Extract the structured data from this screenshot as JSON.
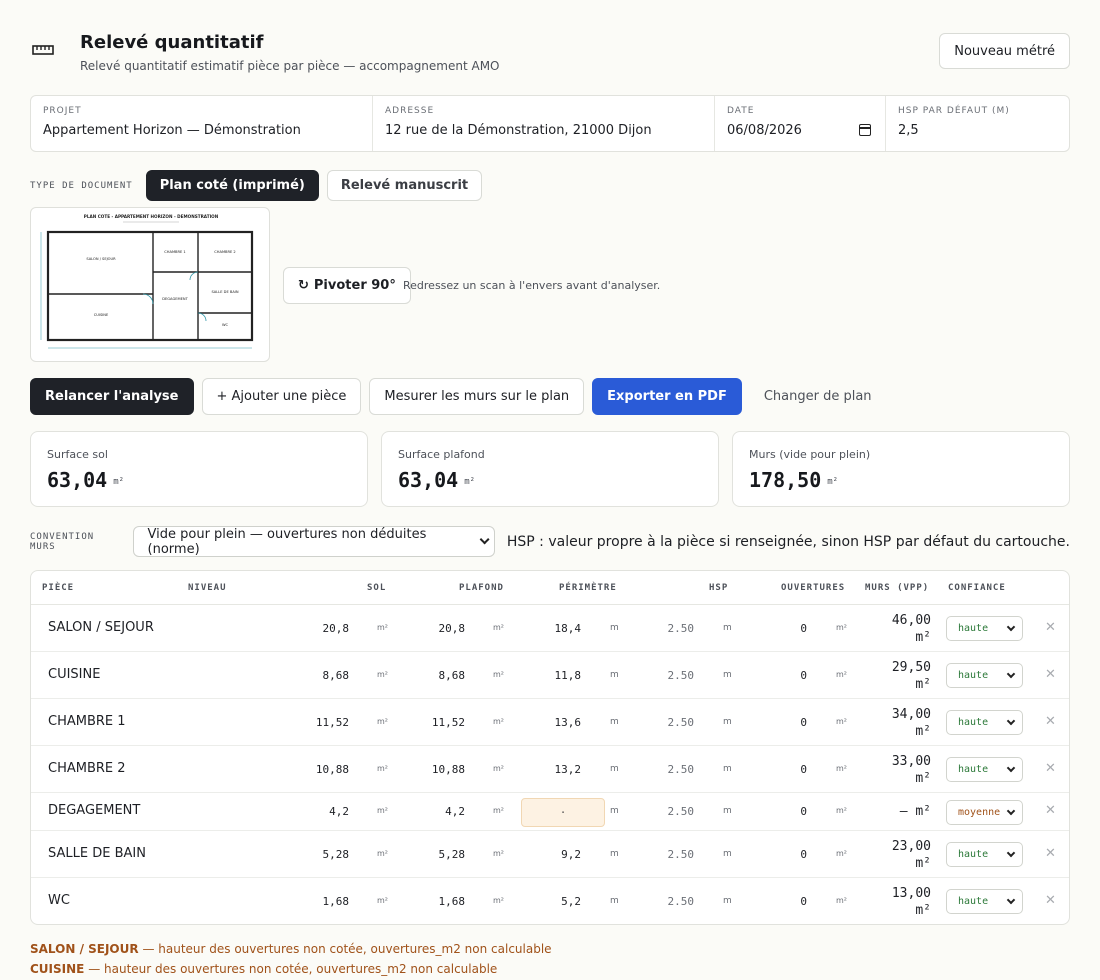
{
  "header": {
    "title": "Relevé quantitatif",
    "subtitle": "Relevé quantitatif estimatif pièce par pièce — accompagnement AMO",
    "new_button": "Nouveau métré",
    "icon": "ruler-icon"
  },
  "project": {
    "fields": [
      {
        "label": "PROJET",
        "value": "Appartement Horizon — Démonstration"
      },
      {
        "label": "ADRESSE",
        "value": "12 rue de la Démonstration, 21000 Dijon"
      },
      {
        "label": "DATE",
        "value": "06/08/2026"
      },
      {
        "label": "HSP PAR DÉFAUT (M)",
        "value": "2,5"
      }
    ]
  },
  "doc_type": {
    "label": "TYPE DE DOCUMENT",
    "options": [
      "Plan coté (imprimé)",
      "Relevé manuscrit"
    ],
    "selected": "Plan coté (imprimé)"
  },
  "plan": {
    "title": "PLAN COTE - APPARTEMENT HORIZON - DEMONSTRATION",
    "rooms": [
      "SALON / SEJOUR",
      "CHAMBRE 1",
      "CHAMBRE 2",
      "SALLE DE BAIN",
      "DEGAGEMENT",
      "CUISINE",
      "WC"
    ],
    "rotate_button": "Pivoter 90°",
    "rotate_hint": "Redressez un scan à l'envers avant d'analyser."
  },
  "actions": {
    "rerun": "Relancer l'analyse",
    "add_room": "+ Ajouter une pièce",
    "measure_walls": "Mesurer les murs sur le plan",
    "export_pdf": "Exporter en PDF",
    "change_plan": "Changer de plan"
  },
  "summary": [
    {
      "label": "Surface sol",
      "value": "63,04",
      "unit": "m²"
    },
    {
      "label": "Surface plafond",
      "value": "63,04",
      "unit": "m²"
    },
    {
      "label": "Murs (vide pour plein)",
      "value": "178,50",
      "unit": "m²"
    }
  ],
  "convention": {
    "label": "CONVENTION MURS",
    "selected": "Vide pour plein — ouvertures non déduites (norme)",
    "note": "HSP : valeur propre à la pièce si renseignée, sinon HSP par défaut du cartouche."
  },
  "table": {
    "headers": [
      "PIÈCE",
      "NIVEAU",
      "SOL",
      "PLAFOND",
      "PÉRIMÈTRE",
      "HSP",
      "OUVERTURES",
      "MURS (VPP)",
      "CONFIANCE"
    ],
    "unit_m2": "m²",
    "unit_m": "m",
    "rows": [
      {
        "name": "SALON / SEJOUR",
        "sol": "20,8",
        "plafond": "20,8",
        "perimetre": "18,4",
        "hsp": "2.50",
        "ouvertures": "0",
        "murs": "46,00",
        "confiance": "haute"
      },
      {
        "name": "CUISINE",
        "sol": "8,68",
        "plafond": "8,68",
        "perimetre": "11,8",
        "hsp": "2.50",
        "ouvertures": "0",
        "murs": "29,50",
        "confiance": "haute"
      },
      {
        "name": "CHAMBRE 1",
        "sol": "11,52",
        "plafond": "11,52",
        "perimetre": "13,6",
        "hsp": "2.50",
        "ouvertures": "0",
        "murs": "34,00",
        "confiance": "haute"
      },
      {
        "name": "CHAMBRE 2",
        "sol": "10,88",
        "plafond": "10,88",
        "perimetre": "13,2",
        "hsp": "2.50",
        "ouvertures": "0",
        "murs": "33,00",
        "confiance": "haute"
      },
      {
        "name": "DEGAGEMENT",
        "sol": "4,2",
        "plafond": "4,2",
        "perimetre": "·",
        "hsp": "2.50",
        "ouvertures": "0",
        "murs": "—",
        "confiance": "moyenne"
      },
      {
        "name": "SALLE DE BAIN",
        "sol": "5,28",
        "plafond": "5,28",
        "perimetre": "9,2",
        "hsp": "2.50",
        "ouvertures": "0",
        "murs": "23,00",
        "confiance": "haute"
      },
      {
        "name": "WC",
        "sol": "1,68",
        "plafond": "1,68",
        "perimetre": "5,2",
        "hsp": "2.50",
        "ouvertures": "0",
        "murs": "13,00",
        "confiance": "haute"
      }
    ]
  },
  "warnings": [
    {
      "room": "SALON / SEJOUR",
      "text": "— hauteur des ouvertures non cotée, ouvertures_m2 non calculable"
    },
    {
      "room": "CUISINE",
      "text": "— hauteur des ouvertures non cotée, ouvertures_m2 non calculable"
    }
  ],
  "colors": {
    "primary_dark": "#1f2228",
    "accent_blue": "#2a5bd7",
    "confidence_high": "#2d7a3a",
    "confidence_medium": "#a0521a",
    "warning": "#a0521a"
  }
}
